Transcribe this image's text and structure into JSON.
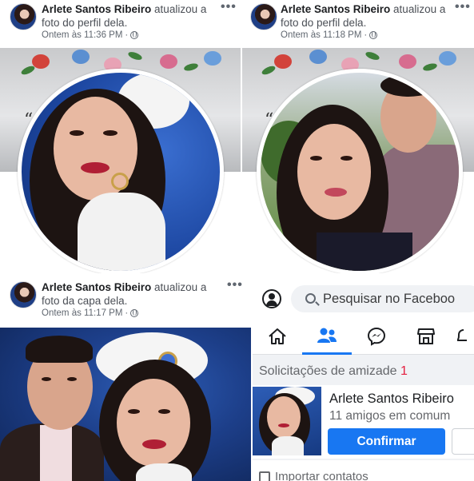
{
  "posts": [
    {
      "author": "Arlete Santos Ribeiro",
      "action": "atualizou a foto do perfil dela.",
      "time": "Ontem às 11:36 PM",
      "menu": "•••"
    },
    {
      "author": "Arlete Santos Ribeiro",
      "action": "atualizou a foto do perfil dela.",
      "time": "Ontem às 11:18 PM",
      "menu": "•••"
    },
    {
      "author": "Arlete Santos Ribeiro",
      "action": "atualizou a foto da capa dela.",
      "time": "Ontem às 11:17 PM",
      "menu": "•••"
    }
  ],
  "cover_quote": "“",
  "facebook": {
    "search_placeholder": "Pesquisar no Faceboo",
    "tabs": [
      {
        "icon": "home-icon",
        "active": false
      },
      {
        "icon": "friends-icon",
        "active": true
      },
      {
        "icon": "messenger-icon",
        "active": false
      },
      {
        "icon": "marketplace-icon",
        "active": false
      }
    ],
    "friend_requests": {
      "title": "Solicitações de amizade",
      "count": "1",
      "name": "Arlete Santos Ribeiro",
      "mutual": "11 amigos em comum",
      "confirm_label": "Confirmar"
    },
    "import_contacts": "Importar contatos"
  },
  "colors": {
    "accent": "#1877f2",
    "badge": "#e41e3f",
    "muted": "#65676b"
  }
}
